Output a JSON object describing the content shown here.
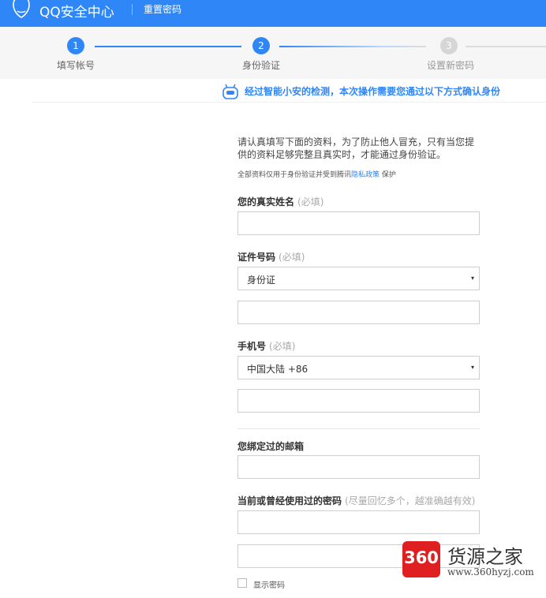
{
  "header": {
    "brand": "QQ安全中心",
    "subnav": "重置密码"
  },
  "steps": [
    {
      "number": "1",
      "label": "填写帐号",
      "state": "done"
    },
    {
      "number": "2",
      "label": "身份验证",
      "state": "current"
    },
    {
      "number": "3",
      "label": "设置新密码",
      "state": "pending"
    }
  ],
  "notice": "经过智能小安的检测，本次操作需要您通过以下方式确认身份",
  "intro": {
    "text": "请认真填写下面的资料，为了防止他人冒充，只有当您提供的资料足够完整且真实时，才能通过身份验证。",
    "small_prefix": "全部资料仅用于身份验证并受到腾讯",
    "small_link": "隐私政策",
    "small_suffix": "保护"
  },
  "form": {
    "name_label": "您的真实姓名",
    "name_hint": "(必填)",
    "id_label": "证件号码",
    "id_hint": "(必填)",
    "id_type_selected": "身份证",
    "phone_label": "手机号",
    "phone_hint": "(必填)",
    "phone_region_selected": "中国大陆 +86",
    "email_label": "您绑定过的邮箱",
    "password_label": "当前或曾经使用过的密码",
    "password_hint": "(尽量回忆多个，越准确越有效)",
    "show_password_label": "显示密码",
    "caret": "▾"
  },
  "watermark": {
    "badge": "360",
    "title": "货源之家",
    "url": "www.360hyzj.com"
  },
  "colors": {
    "header_blue": "#2f86f6",
    "step_done": "#2f86f6",
    "step_pending": "#d6d6d6"
  }
}
